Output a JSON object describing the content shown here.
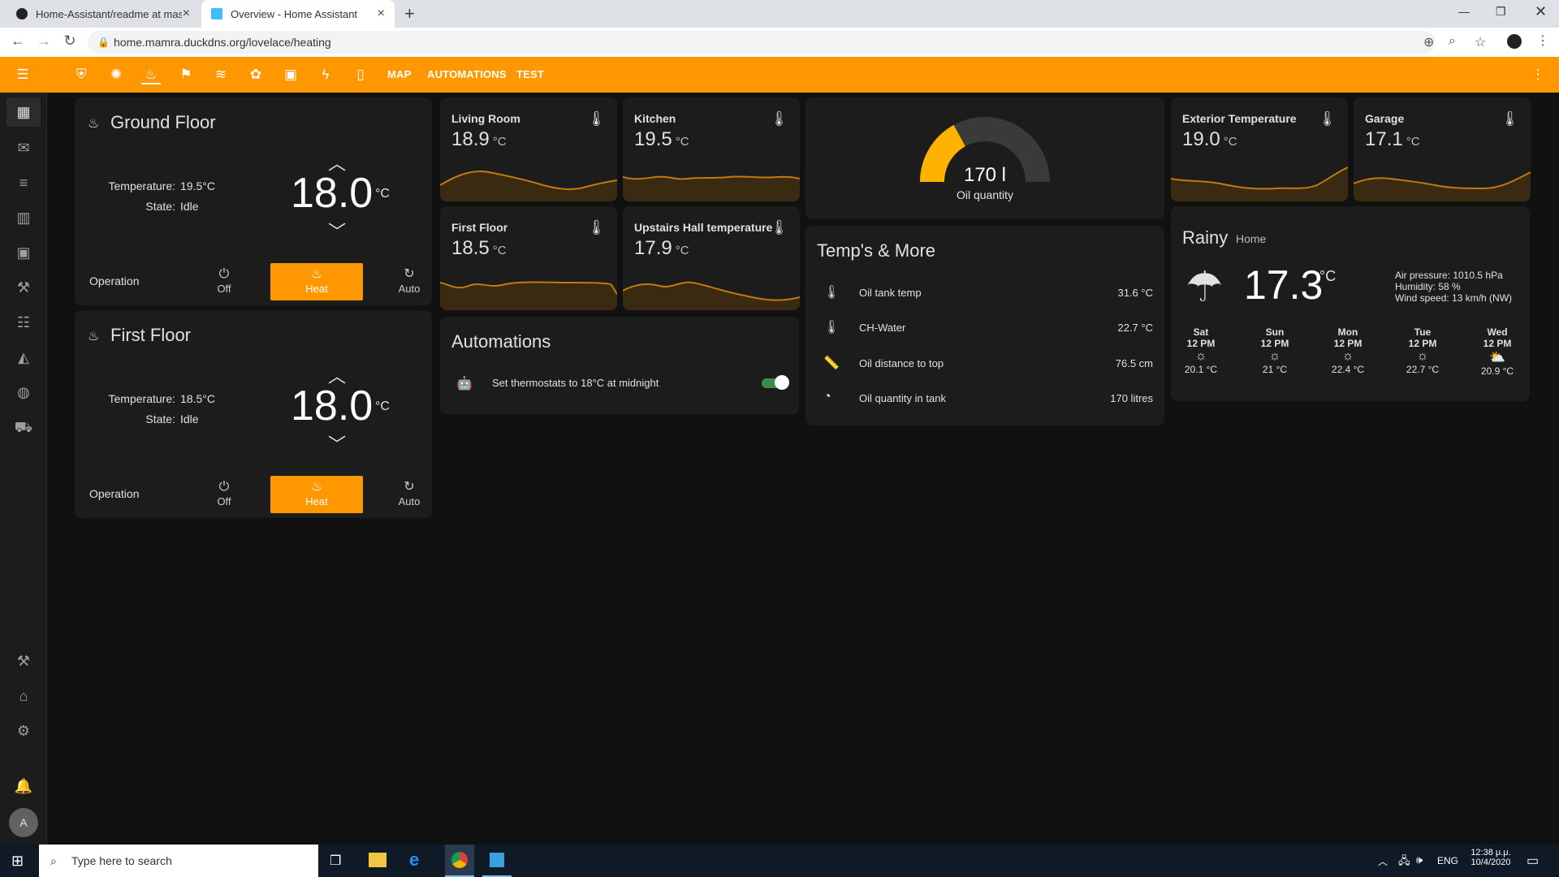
{
  "browser": {
    "tabs": [
      {
        "label": "Home-Assistant/readme at maste",
        "active": false
      },
      {
        "label": "Overview - Home Assistant",
        "active": true
      }
    ],
    "url": "home.mamra.duckdns.org/lovelace/heating"
  },
  "toolbar": {
    "text_tabs": [
      "MAP",
      "AUTOMATIONS",
      "TEST"
    ],
    "accent": "#ff9800"
  },
  "thermostats": [
    {
      "title": "Ground Floor",
      "temperature_label": "Temperature:",
      "temperature_value": "19.5°C",
      "state_label": "State:",
      "state_value": "Idle",
      "setpoint": "18.0",
      "unit": "°C",
      "operation_label": "Operation",
      "modes": [
        "Off",
        "Heat",
        "Auto"
      ],
      "active_mode": "Heat"
    },
    {
      "title": "First Floor",
      "temperature_label": "Temperature:",
      "temperature_value": "18.5°C",
      "state_label": "State:",
      "state_value": "Idle",
      "setpoint": "18.0",
      "unit": "°C",
      "operation_label": "Operation",
      "modes": [
        "Off",
        "Heat",
        "Auto"
      ],
      "active_mode": "Heat"
    }
  ],
  "sensors": {
    "living_room": {
      "name": "Living Room",
      "value": "18.9",
      "unit": "°C"
    },
    "kitchen": {
      "name": "Kitchen",
      "value": "19.5",
      "unit": "°C"
    },
    "first_floor": {
      "name": "First Floor",
      "value": "18.5",
      "unit": "°C"
    },
    "upstairs_hall": {
      "name": "Upstairs Hall temperature",
      "value": "17.9",
      "unit": "°C"
    },
    "exterior": {
      "name": "Exterior Temperature",
      "value": "19.0",
      "unit": "°C"
    },
    "garage": {
      "name": "Garage",
      "value": "17.1",
      "unit": "°C"
    }
  },
  "gauge": {
    "value": "170 l",
    "label": "Oil quantity",
    "fraction": 0.34
  },
  "automations": {
    "title": "Automations",
    "items": [
      {
        "label": "Set thermostats to 18°C at midnight",
        "enabled": true
      }
    ]
  },
  "temps_more": {
    "title": "Temp's & More",
    "rows": [
      {
        "name": "Oil tank temp",
        "value": "31.6 °C",
        "icon": "thermometer-icon"
      },
      {
        "name": "CH-Water",
        "value": "22.7 °C",
        "icon": "thermometer-icon"
      },
      {
        "name": "Oil distance to top",
        "value": "76.5 cm",
        "icon": "ruler-icon"
      },
      {
        "name": "Oil quantity in tank",
        "value": "170 litres",
        "icon": "gauge-icon"
      }
    ]
  },
  "weather": {
    "condition": "Rainy",
    "location": "Home",
    "temperature": "17.3",
    "unit": "°C",
    "pressure": "Air pressure: 1010.5 hPa",
    "humidity": "Humidity: 58 %",
    "wind": "Wind speed: 13 km/h (NW)",
    "forecast": [
      {
        "day": "Sat",
        "time": "12 PM",
        "temp": "20.1 °C",
        "icon": "sunny-icon"
      },
      {
        "day": "Sun",
        "time": "12 PM",
        "temp": "21 °C",
        "icon": "sunny-icon"
      },
      {
        "day": "Mon",
        "time": "12 PM",
        "temp": "22.4 °C",
        "icon": "sunny-icon"
      },
      {
        "day": "Tue",
        "time": "12 PM",
        "temp": "22.7 °C",
        "icon": "sunny-icon"
      },
      {
        "day": "Wed",
        "time": "12 PM",
        "temp": "20.9 °C",
        "icon": "partly-cloudy-icon"
      }
    ]
  },
  "taskbar": {
    "search_placeholder": "Type here to search",
    "lang": "ENG",
    "time": "12:38 μ.μ.",
    "date": "10/4/2020"
  }
}
